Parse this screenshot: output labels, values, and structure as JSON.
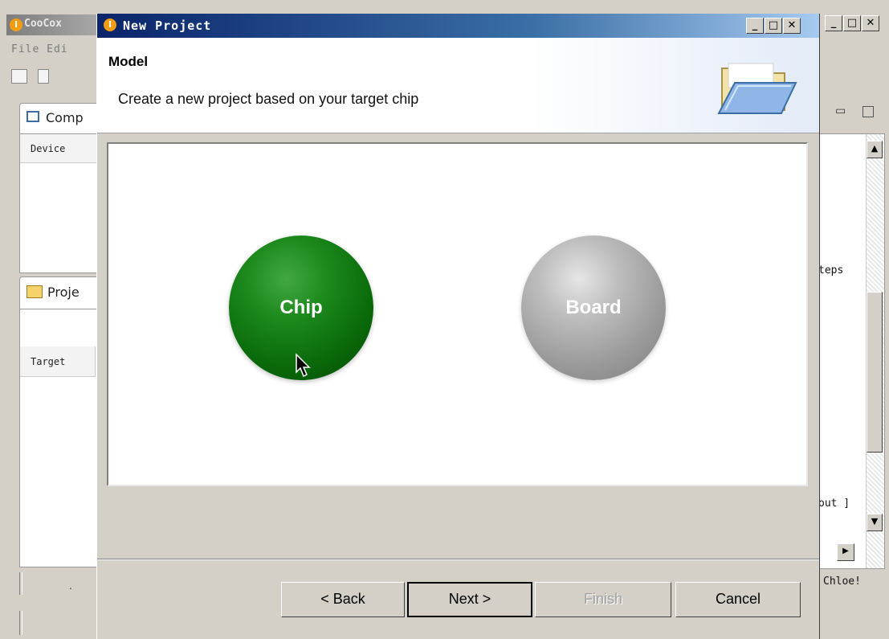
{
  "main_window": {
    "title": "CooCox",
    "menu": "File Edi",
    "components_tab": "Comp",
    "device_header": "Device",
    "project_tab": "Proje",
    "target_header": "Target",
    "right_text_1": "teps",
    "right_text_2": "out ]",
    "right_text_3": "Chloe!",
    "status_dot": "."
  },
  "dialog": {
    "title": "New Project",
    "header_title": "Model",
    "header_desc": "Create a new project based on your target chip",
    "options": [
      {
        "label": "Chip",
        "color": "#0a6a0a",
        "selected": true
      },
      {
        "label": "Board",
        "color": "#9a9a9a",
        "selected": false
      }
    ],
    "buttons": {
      "back": "< Back",
      "next": "Next >",
      "finish": "Finish",
      "cancel": "Cancel"
    },
    "finish_enabled": false
  },
  "icons": [
    "app-logo-icon",
    "folder-icon",
    "new-file-icon",
    "document-icon",
    "window-icon",
    "project-folder-icon",
    "mouse-cursor-icon"
  ]
}
